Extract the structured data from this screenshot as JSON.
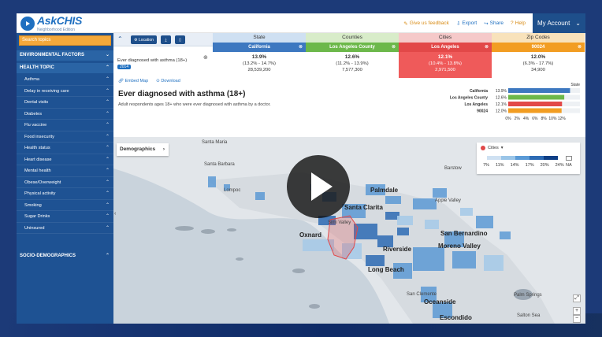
{
  "header": {
    "logo_title": "AskCHIS",
    "logo_subtitle": "Neighborhood Edition",
    "links": [
      {
        "label": "Give us feedback",
        "icon": "megaphone-icon"
      },
      {
        "label": "Export",
        "icon": "export-icon"
      },
      {
        "label": "Share",
        "icon": "share-icon"
      },
      {
        "label": "Help",
        "icon": "help-icon"
      }
    ],
    "account_label": "My Account"
  },
  "sidebar": {
    "search_placeholder": "Search topics",
    "env_label": "ENVIRONMENTAL FACTORS",
    "health_label": "HEALTH TOPIC",
    "items": [
      "Asthma",
      "Delay in receiving care",
      "Dental visits",
      "Diabetes",
      "Flu vaccine",
      "Food insecurity",
      "Health status",
      "Heart disease",
      "Mental health",
      "Obese/Overweight",
      "Physical activity",
      "Smoking",
      "Sugar Drinks",
      "Uninsured"
    ],
    "socio_label": "SOCIO-DEMOGRAPHICS"
  },
  "toolbar": {
    "location_label": "Location"
  },
  "geographies": [
    {
      "header": "State",
      "selection": "California",
      "value": "13.9%",
      "ci": "(13.2% - 14.7%)",
      "pop": "28,539,200",
      "color": "#3d78c0",
      "header_bg": "#cfe0f2"
    },
    {
      "header": "Counties",
      "selection": "Los Angeles County",
      "value": "12.6%",
      "ci": "(11.2% - 13.9%)",
      "pop": "7,577,300",
      "color": "#6cb84a",
      "header_bg": "#d8ecc9"
    },
    {
      "header": "Cities",
      "selection": "Los Angeles",
      "value": "12.1%",
      "ci": "(10.4% - 13.8%)",
      "pop": "2,971,500",
      "color": "#e24848",
      "header_bg": "#f5c9c9"
    },
    {
      "header": "Zip Codes",
      "selection": "90024",
      "value": "12.0%",
      "ci": "(6.3% - 17.7%)",
      "pop": "34,900",
      "color": "#f29d22",
      "header_bg": "#f8e2bb"
    }
  ],
  "measure": {
    "label": "Ever diagnosed with asthma (18+)",
    "year": "2014"
  },
  "actions": {
    "embed": "Embed Map",
    "download": "Download"
  },
  "title": "Ever diagnosed with asthma (18+)",
  "description": "Adult respondents ages 18+ who were ever diagnosed with asthma by a doctor.",
  "chart_data": {
    "type": "bar",
    "categories": [
      "California",
      "Los Angeles County",
      "Los Angeles",
      "90024"
    ],
    "values": [
      13.9,
      12.6,
      12.1,
      12.0
    ],
    "value_labels": [
      "13.9%",
      "12.6%",
      "12.1%",
      "12.0%"
    ],
    "colors": [
      "#3d78c0",
      "#6cb84a",
      "#e24848",
      "#f29d22"
    ],
    "xlim": [
      0,
      14
    ],
    "xticks": [
      "0%",
      "2%",
      "4%",
      "6%",
      "8%",
      "10%",
      "12%"
    ],
    "legend": "State"
  },
  "map": {
    "demographics_label": "Demographics",
    "legend_label": "Cities",
    "legend_colors": [
      "#cfe1f2",
      "#9ac5e8",
      "#5a9ad6",
      "#2d6bb4",
      "#0e3f86"
    ],
    "legend_ticks": [
      "7%",
      "11%",
      "14%",
      "17%",
      "20%",
      "24%"
    ],
    "na_label": "NA",
    "places": [
      {
        "name": "Santa Maria",
        "big": false
      },
      {
        "name": "Santa Barbara",
        "big": false
      },
      {
        "name": "Lompoc",
        "big": false
      },
      {
        "name": "Palmdale",
        "big": true
      },
      {
        "name": "Santa Clarita",
        "big": true
      },
      {
        "name": "Oxnard",
        "big": true
      },
      {
        "name": "Apple Valley",
        "big": false
      },
      {
        "name": "San Bernardino",
        "big": true
      },
      {
        "name": "Riverside",
        "big": true
      },
      {
        "name": "Moreno Valley",
        "big": true
      },
      {
        "name": "Long Beach",
        "big": true
      },
      {
        "name": "Oceanside",
        "big": true
      },
      {
        "name": "Escondido",
        "big": true
      },
      {
        "name": "Barstow",
        "big": false
      },
      {
        "name": "Simi Valley",
        "big": false
      },
      {
        "name": "San Clemente",
        "big": false
      },
      {
        "name": "Palm Springs",
        "big": false
      },
      {
        "name": "Salton Sea",
        "big": false
      }
    ]
  }
}
